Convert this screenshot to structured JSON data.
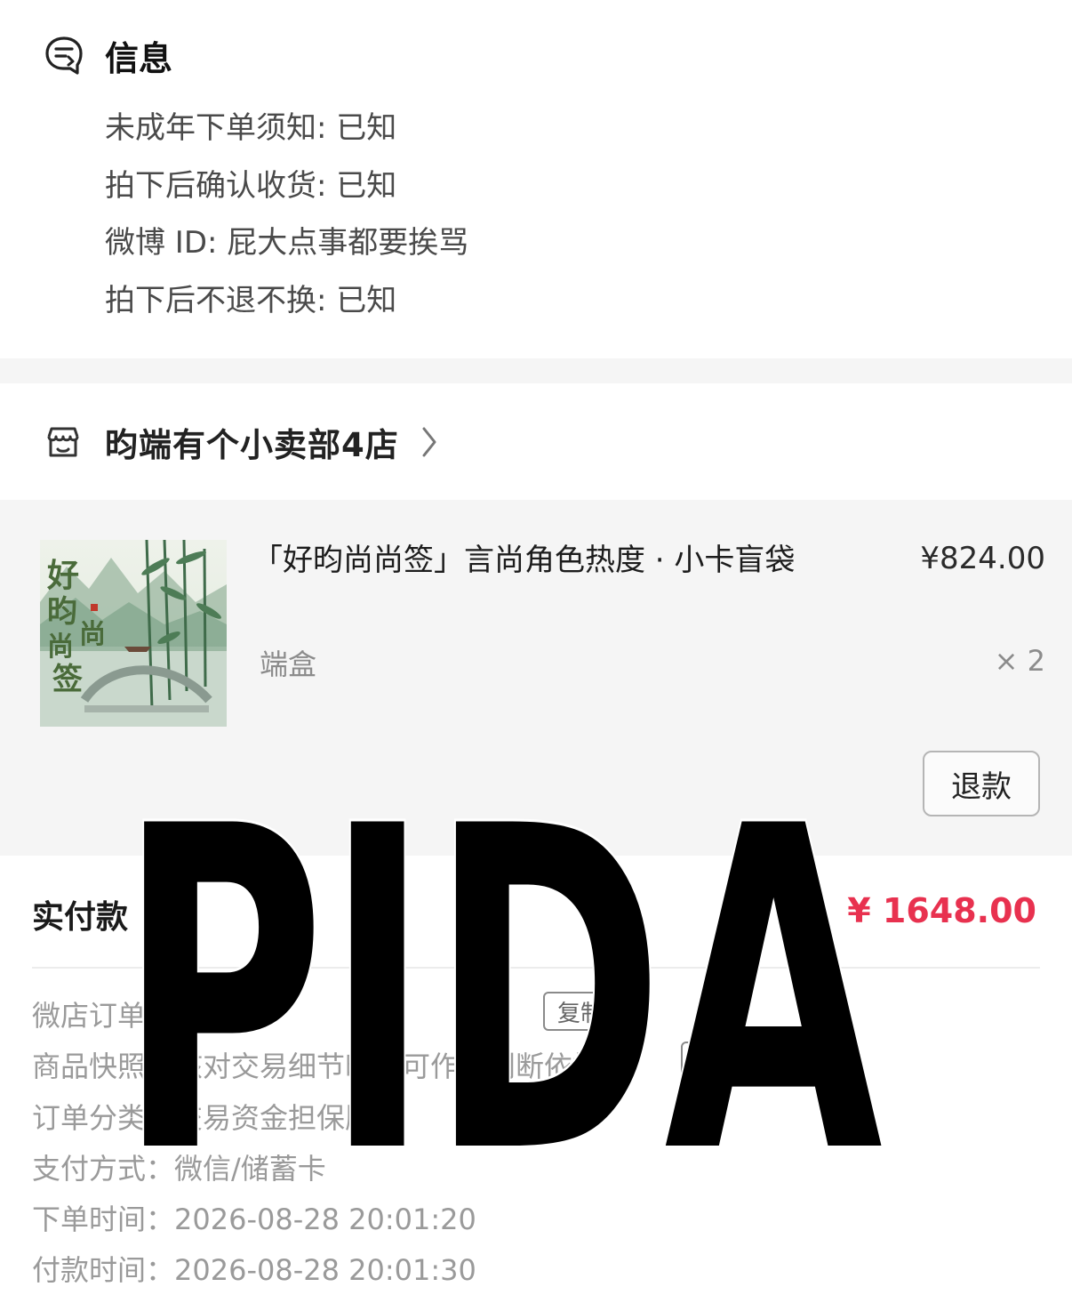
{
  "info": {
    "title": "信息",
    "icon": "chat-note-icon",
    "lines": [
      "未成年下单须知: 已知",
      "拍下后确认收货: 已知",
      "微博 ID: 屁大点事都要挨骂",
      "拍下后不退不换: 已知"
    ]
  },
  "shop": {
    "icon": "storefront-icon",
    "name": "昀端有个小卖部4店",
    "chevron": "chevron-right-icon"
  },
  "product": {
    "image_text": "好昀尚尚签",
    "title": "「好昀尚尚签」言尚角色热度 · 小卡盲袋",
    "price": "¥824.00",
    "spec": "端盒",
    "quantity": "× 2",
    "refund_label": "退款"
  },
  "payment": {
    "paid_label": "实付款",
    "paid_value": "¥ 1648.00",
    "paid_color": "#e8314f",
    "details": [
      {
        "key": "微店订单号：",
        "value": ""
      },
      {
        "key": "商品快照：",
        "value": "核对交易细节时，可作为判断依据"
      },
      {
        "key": "订单分类：",
        "value": "交易资金担保服务"
      },
      {
        "key": "支付方式：",
        "value": "微信/储蓄卡"
      },
      {
        "key": "下单时间：",
        "value": "2026-08-28 20:01:20"
      },
      {
        "key": "付款时间：",
        "value": "2026-08-28 20:01:30"
      }
    ],
    "copy_label": "复制"
  },
  "watermark": {
    "text": "PIDA",
    "color": "#000000"
  }
}
